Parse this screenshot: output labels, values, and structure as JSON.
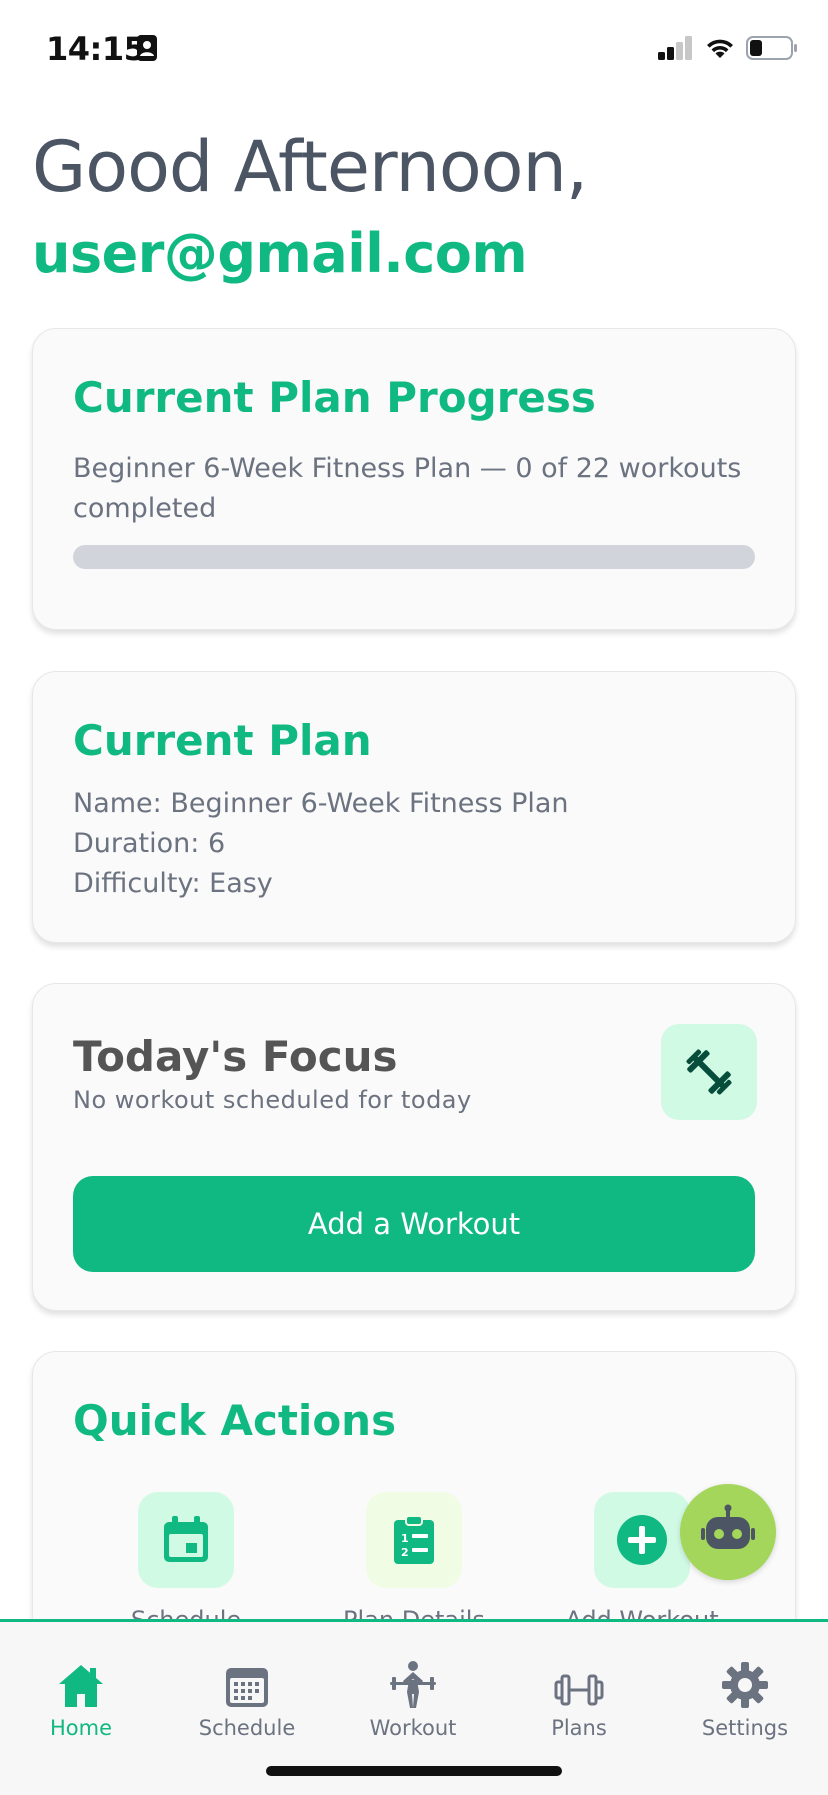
{
  "status_bar": {
    "time": "14:15"
  },
  "header": {
    "greeting": "Good Afternoon,",
    "email": "user@gmail.com"
  },
  "progress_card": {
    "title": "Current Plan Progress",
    "description": "Beginner 6-Week Fitness Plan — 0 of 22 workouts completed",
    "progress_fraction": 0
  },
  "plan_card": {
    "title": "Current Plan",
    "name_line": "Name: Beginner 6-Week Fitness Plan",
    "duration_line": "Duration: 6",
    "difficulty_line": "Difficulty: Easy"
  },
  "focus_card": {
    "title": "Today's Focus",
    "subtitle": "No workout scheduled for today",
    "icon": "barbell-icon",
    "button_label": "Add a Workout"
  },
  "quick_actions": {
    "title": "Quick Actions",
    "items": [
      {
        "label": "Schedule",
        "icon": "calendar-icon"
      },
      {
        "label": "Plan Details",
        "icon": "clipboard-list-icon"
      },
      {
        "label": "Add Workout",
        "icon": "plus-circle-icon"
      }
    ]
  },
  "assistant": {
    "icon": "robot-icon"
  },
  "tab_bar": {
    "tabs": [
      {
        "label": "Home",
        "icon": "home-icon",
        "active": true
      },
      {
        "label": "Schedule",
        "icon": "calendar-grid-icon",
        "active": false
      },
      {
        "label": "Workout",
        "icon": "weightlifter-icon",
        "active": false
      },
      {
        "label": "Plans",
        "icon": "dumbbell-icon",
        "active": false
      },
      {
        "label": "Settings",
        "icon": "gear-icon",
        "active": false
      }
    ]
  },
  "colors": {
    "accent": "#10b981",
    "accent_light": "#d1fae5",
    "assistant": "#a3d65a",
    "text_muted": "#6b7280"
  }
}
